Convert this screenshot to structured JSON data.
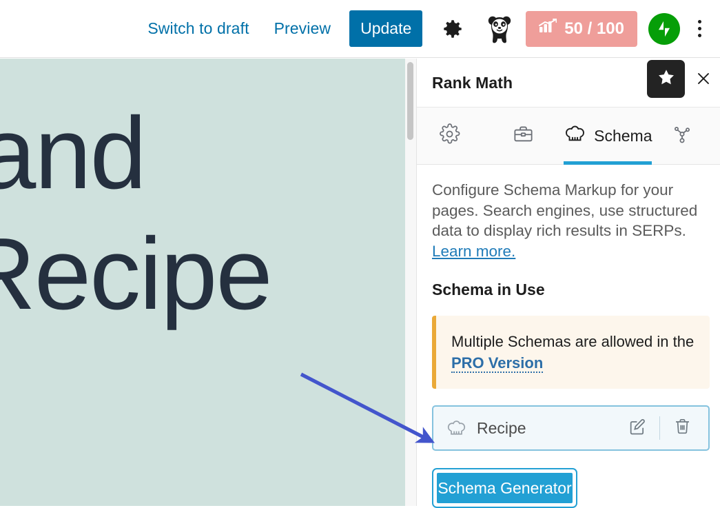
{
  "topbar": {
    "switch_to_draft": "Switch to draft",
    "preview": "Preview",
    "update": "Update",
    "settings_icon": "gear-icon",
    "panda_icon": "panda-icon",
    "seo_score": "50 / 100",
    "seo_score_icon": "seo-bar-chart-icon",
    "seo_badge_color": "#ef9e9a",
    "jetpack_icon": "jetpack-icon",
    "jetpack_color": "#069e08",
    "more_options_icon": "kebab-menu-icon",
    "link_color": "#0070a8"
  },
  "canvas": {
    "line1": "and",
    "line2": "Recipe",
    "background_color": "#cfe1dd",
    "text_color": "#25303f"
  },
  "panel": {
    "title": "Rank Math",
    "favorite_icon": "star-icon",
    "close_icon": "close-icon",
    "tabs": [
      {
        "label": "",
        "icon": "gear-icon",
        "active": false
      },
      {
        "label": "",
        "icon": "briefcase-icon",
        "active": false
      },
      {
        "label": "Schema",
        "icon": "chef-hat-icon",
        "active": true
      },
      {
        "label": "",
        "icon": "social-share-icon",
        "active": false
      }
    ],
    "active_tab_color": "#22a0d4",
    "intro": {
      "text": "Configure Schema Markup for your pages. Search engines, use structured data to display rich results in SERPs. ",
      "link": "Learn more."
    },
    "section_title": "Schema in Use",
    "notice": {
      "text_before": "Multiple Schemas are allowed in the ",
      "link": "PRO Version",
      "accent_color": "#eaa938",
      "background_color": "#fdf6ec"
    },
    "schema_card": {
      "icon": "chef-hat-icon",
      "name": "Recipe",
      "edit_icon": "edit-pencil-icon",
      "delete_icon": "trash-icon",
      "border_color": "#84c2de"
    },
    "generator_button": {
      "label": "Schema Generator",
      "color": "#22a0d4"
    }
  },
  "annotation": {
    "arrow_color": "#4355cc",
    "arrow_icon": "pointer-arrow"
  }
}
